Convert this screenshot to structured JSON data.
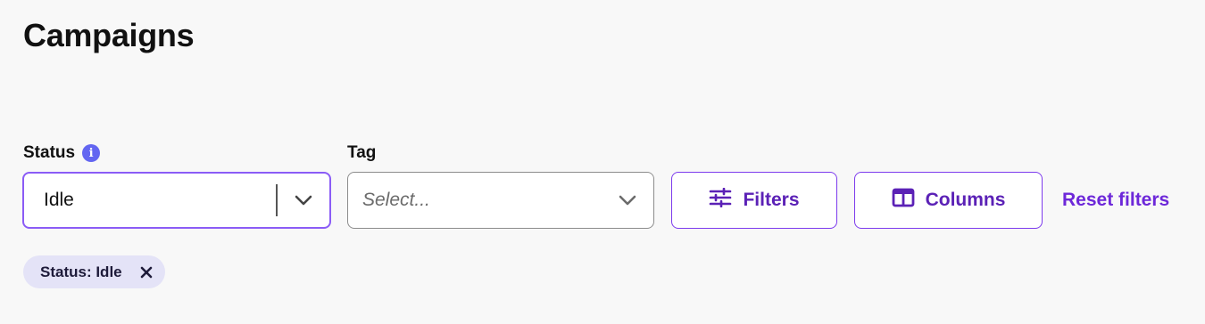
{
  "page": {
    "title": "Campaigns"
  },
  "filters": {
    "status": {
      "label": "Status",
      "info_icon": "info-icon",
      "value": "Idle"
    },
    "tag": {
      "label": "Tag",
      "placeholder": "Select..."
    },
    "filters_button": {
      "label": "Filters",
      "icon": "sliders-icon"
    },
    "columns_button": {
      "label": "Columns",
      "icon": "columns-icon"
    },
    "reset_link": "Reset filters"
  },
  "active_chips": [
    {
      "label": "Status: Idle",
      "remove_icon": "close-icon"
    }
  ],
  "colors": {
    "accent": "#7c3aed",
    "accent_text": "#5b21b6",
    "info": "#6366f1",
    "chip_bg": "#e4e3f7",
    "page_bg": "#f8f8f8"
  }
}
